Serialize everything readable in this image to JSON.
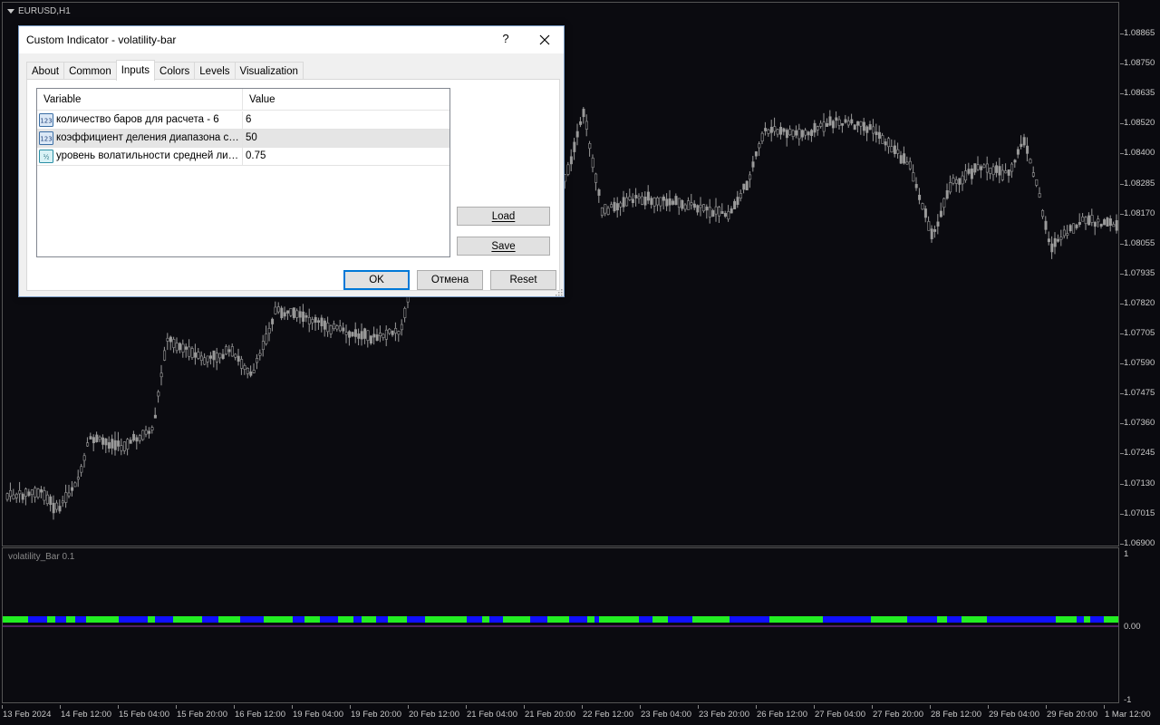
{
  "chart": {
    "symbol_label": "EURUSD,H1",
    "indicator_label": "volatility_Bar 0.1",
    "price_labels": [
      "1.08865",
      "1.08750",
      "1.08635",
      "1.08520",
      "1.08400",
      "1.08285",
      "1.08170",
      "1.08055",
      "1.07935",
      "1.07820",
      "1.07705",
      "1.07590",
      "1.07475",
      "1.07360",
      "1.07245",
      "1.07130",
      "1.07015",
      "1.06900"
    ],
    "indicator_scale": [
      "1",
      "0.00",
      "-1"
    ],
    "time_labels": [
      "13 Feb 2024",
      "14 Feb 12:00",
      "15 Feb 04:00",
      "15 Feb 20:00",
      "16 Feb 12:00",
      "19 Feb 04:00",
      "19 Feb 20:00",
      "20 Feb 12:00",
      "21 Feb 04:00",
      "21 Feb 20:00",
      "22 Feb 12:00",
      "23 Feb 04:00",
      "23 Feb 20:00",
      "26 Feb 12:00",
      "27 Feb 04:00",
      "27 Feb 20:00",
      "28 Feb 12:00",
      "29 Feb 04:00",
      "29 Feb 20:00",
      "1 Mar 12:00"
    ],
    "colors": {
      "background": "#0b0b10",
      "candle": "#9a9a9a",
      "bar_high": "#22ee22",
      "bar_low": "#1010ff",
      "midline": "#9a3ab0"
    }
  },
  "dialog": {
    "title": "Custom Indicator - volatility-bar",
    "help_label": "?",
    "tabs": [
      {
        "label": "About"
      },
      {
        "label": "Common"
      },
      {
        "label": "Inputs"
      },
      {
        "label": "Colors"
      },
      {
        "label": "Levels"
      },
      {
        "label": "Visualization"
      }
    ],
    "active_tab": "Inputs",
    "table": {
      "col_variable": "Variable",
      "col_value": "Value",
      "rows": [
        {
          "icon": "int-icon",
          "name": "количество баров для расчета - 6",
          "value": "6"
        },
        {
          "icon": "int-icon",
          "name": "коэффициент деления диапазона свечей",
          "value": "50"
        },
        {
          "icon": "double-icon",
          "name": "уровень волатильности средней линии",
          "value": "0.75"
        }
      ]
    },
    "buttons": {
      "load": "Load",
      "save": "Save",
      "ok": "OK",
      "cancel": "Отмена",
      "reset": "Reset"
    }
  }
}
